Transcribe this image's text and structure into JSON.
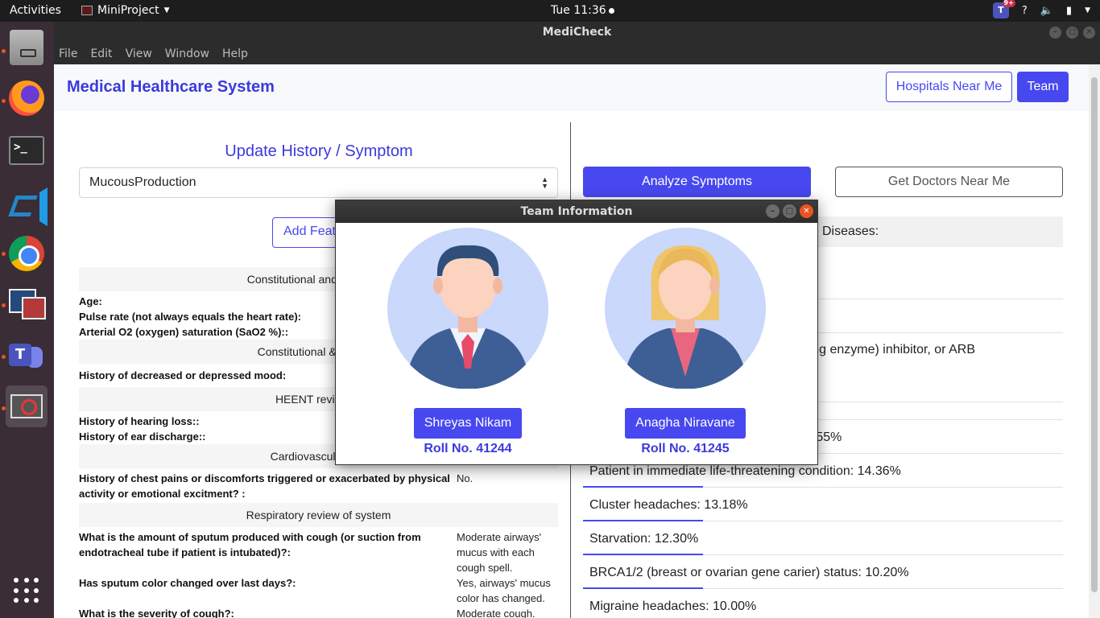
{
  "topbar": {
    "activities": "Activities",
    "app_name": "MiniProject",
    "clock": "Tue 11:36",
    "teams_badge": "9+",
    "help": "?"
  },
  "dock": {
    "items": [
      "Files",
      "Firefox",
      "Terminal",
      "Visual Studio Code",
      "Google Chrome",
      "Image Viewer",
      "Microsoft Teams",
      "MiniProject"
    ]
  },
  "window": {
    "title": "MediCheck",
    "menu": [
      "File",
      "Edit",
      "View",
      "Window",
      "Help"
    ]
  },
  "navbar": {
    "brand": "Medical Healthcare System",
    "hospitals_btn": "Hospitals Near Me",
    "team_btn": "Team"
  },
  "left": {
    "title": "Update History / Symptom",
    "selected_feature": "MucousProduction",
    "add_btn": "Add Feature",
    "sections": [
      {
        "head": "Constitutional and vital signs",
        "rows": [
          {
            "q": "Age:",
            "a": ""
          },
          {
            "q": "Pulse rate (not always equals the heart rate):",
            "a": ""
          },
          {
            "q": "Arterial O2 (oxygen) saturation (SaO2 %)::",
            "a": ""
          }
        ]
      },
      {
        "head": "Constitutional & General",
        "rows": [
          {
            "q": "History of decreased or depressed mood:",
            "a": ""
          }
        ]
      },
      {
        "head": "HEENT review of",
        "rows": [
          {
            "q": "History of hearing loss::",
            "a": ""
          },
          {
            "q": "History of ear discharge::",
            "a": ""
          }
        ]
      },
      {
        "head": "Cardiovascular revi",
        "rows": [
          {
            "q": "History of chest pains or discomforts triggered or exacerbated by physical activity or emotional excitment? :",
            "a": "No."
          }
        ]
      },
      {
        "head": "Respiratory review of system",
        "rows": [
          {
            "q": "What is the amount of sputum produced with cough (or suction from endotracheal tube if patient is intubated)?:",
            "a": "Moderate airways' mucus with each cough spell."
          },
          {
            "q": "Has sputum color changed over last days?:",
            "a": "Yes, airways' mucus color has changed."
          },
          {
            "q": "What is the severity of cough?:",
            "a": "Moderate cough."
          }
        ]
      }
    ]
  },
  "right": {
    "analyze_btn": "Analyze Symptoms",
    "doctors_btn": "Get Doctors Near Me",
    "diseases_head": "Diseases:",
    "rows": [
      "",
      "",
      "verting enzyme) inhibitor, or ARB",
      "",
      "4.55%",
      "Patient in immediate life-threatening condition: 14.36%",
      "Cluster headaches: 13.18%",
      "Starvation: 12.30%",
      "BRCA1/2 (breast or ovarian gene carier) status: 10.20%",
      "Migraine headaches: 10.00%"
    ]
  },
  "dialog": {
    "title": "Team Information",
    "members": [
      {
        "name": "Shreyas Nikam",
        "roll": "Roll No. 41244",
        "avatar": "male-avatar"
      },
      {
        "name": "Anagha Niravane",
        "roll": "Roll No. 41245",
        "avatar": "female-avatar"
      }
    ]
  },
  "colors": {
    "accent": "#4848f0",
    "brand_text": "#3a3ade",
    "avatar_bg": "#c9d8fb",
    "ubuntu_orange": "#e95420"
  }
}
